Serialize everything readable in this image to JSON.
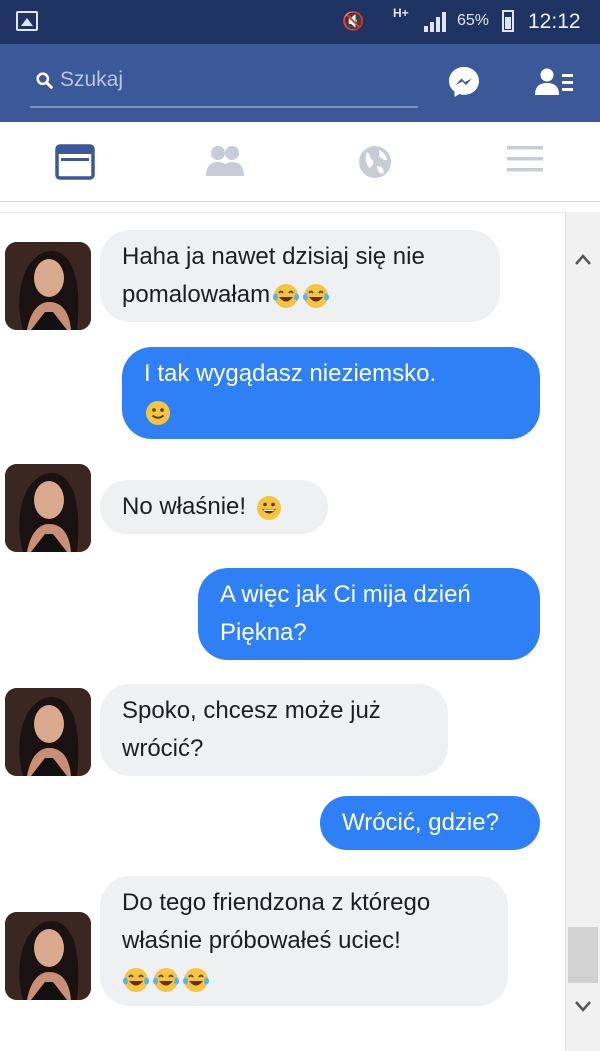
{
  "status_bar": {
    "network": "H+",
    "battery": "65%",
    "time": "12:12"
  },
  "header": {
    "search_placeholder": "Szukaj",
    "icons": [
      "search-icon",
      "messenger-icon",
      "friend-requests-icon"
    ]
  },
  "tabs": [
    {
      "name": "news-feed",
      "icon": "news-feed-icon",
      "active": true
    },
    {
      "name": "friends",
      "icon": "friends-icon",
      "active": false
    },
    {
      "name": "notifications",
      "icon": "globe-icon",
      "active": false
    },
    {
      "name": "menu",
      "icon": "menu-icon",
      "active": false
    }
  ],
  "colors": {
    "header": "#3b5998",
    "status_bar": "#1f3362",
    "outgoing_bubble": "#2f7ff5",
    "incoming_bubble": "#eff0f2",
    "active_tab": "#3b5998"
  },
  "messages": [
    {
      "from": "them",
      "lines": [
        "Haha ja nawet dzisiaj się nie",
        "pomalowałam"
      ],
      "emoji": [
        "laughing-tears",
        "laughing-tears"
      ]
    },
    {
      "from": "me",
      "lines": [
        "I tak wygądasz nieziemsko."
      ],
      "emoji": [
        "slight-smile"
      ]
    },
    {
      "from": "them",
      "lines": [
        "No właśnie!"
      ],
      "emoji": [
        "grin"
      ]
    },
    {
      "from": "me",
      "lines": [
        "A więc jak Ci mija dzień",
        "Piękna?"
      ],
      "emoji": []
    },
    {
      "from": "them",
      "lines": [
        "Spoko, chcesz może już",
        "wrócić?"
      ],
      "emoji": []
    },
    {
      "from": "me",
      "lines": [
        "Wrócić, gdzie?"
      ],
      "emoji": []
    },
    {
      "from": "them",
      "lines": [
        "Do tego friendzona z którego",
        "właśnie próbowałeś uciec!"
      ],
      "emoji": [
        "laughing-tears",
        "laughing-tears",
        "laughing-tears"
      ]
    }
  ]
}
